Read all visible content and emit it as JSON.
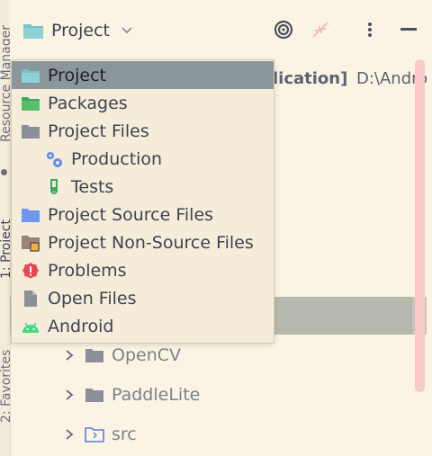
{
  "side_strip": {
    "resource_manager": "Resource Manager",
    "project": "1: Project",
    "favorites": "2: Favorites"
  },
  "header": {
    "title": "Project",
    "chevron_icon": "chevron-down-icon",
    "buttons": [
      "locate-target-icon",
      "collapse-all-icon",
      "more-options-icon",
      "hide-panel-icon"
    ]
  },
  "background": {
    "module_suffix": "lication]",
    "module_path": "D:\\Andro"
  },
  "menu": {
    "items": [
      {
        "label": "Project",
        "icon": "project-folder-icon",
        "active": true
      },
      {
        "label": "Packages",
        "icon": "packages-folder-icon"
      },
      {
        "label": "Project Files",
        "icon": "folder-icon"
      },
      {
        "label": "Production",
        "icon": "production-gears-icon"
      },
      {
        "label": "Tests",
        "icon": "test-tube-icon"
      },
      {
        "label": "Project Source Files",
        "icon": "source-folder-icon"
      },
      {
        "label": "Project Non-Source Files",
        "icon": "non-source-folder-icon"
      },
      {
        "label": "Problems",
        "icon": "problems-icon"
      },
      {
        "label": "Open Files",
        "icon": "file-icon"
      },
      {
        "label": "Android",
        "icon": "android-icon"
      }
    ]
  },
  "tree": {
    "rows": [
      {
        "name": "OpenCV",
        "icon": "folder-icon"
      },
      {
        "name": "PaddleLite",
        "icon": "folder-icon"
      },
      {
        "name": "src",
        "icon": "source-module-folder-icon"
      }
    ]
  },
  "colors": {
    "background": "#fbf4e4",
    "popup": "#f5ecda",
    "active_item": "#8a9699",
    "scrollbar": "#f9c9c9"
  }
}
